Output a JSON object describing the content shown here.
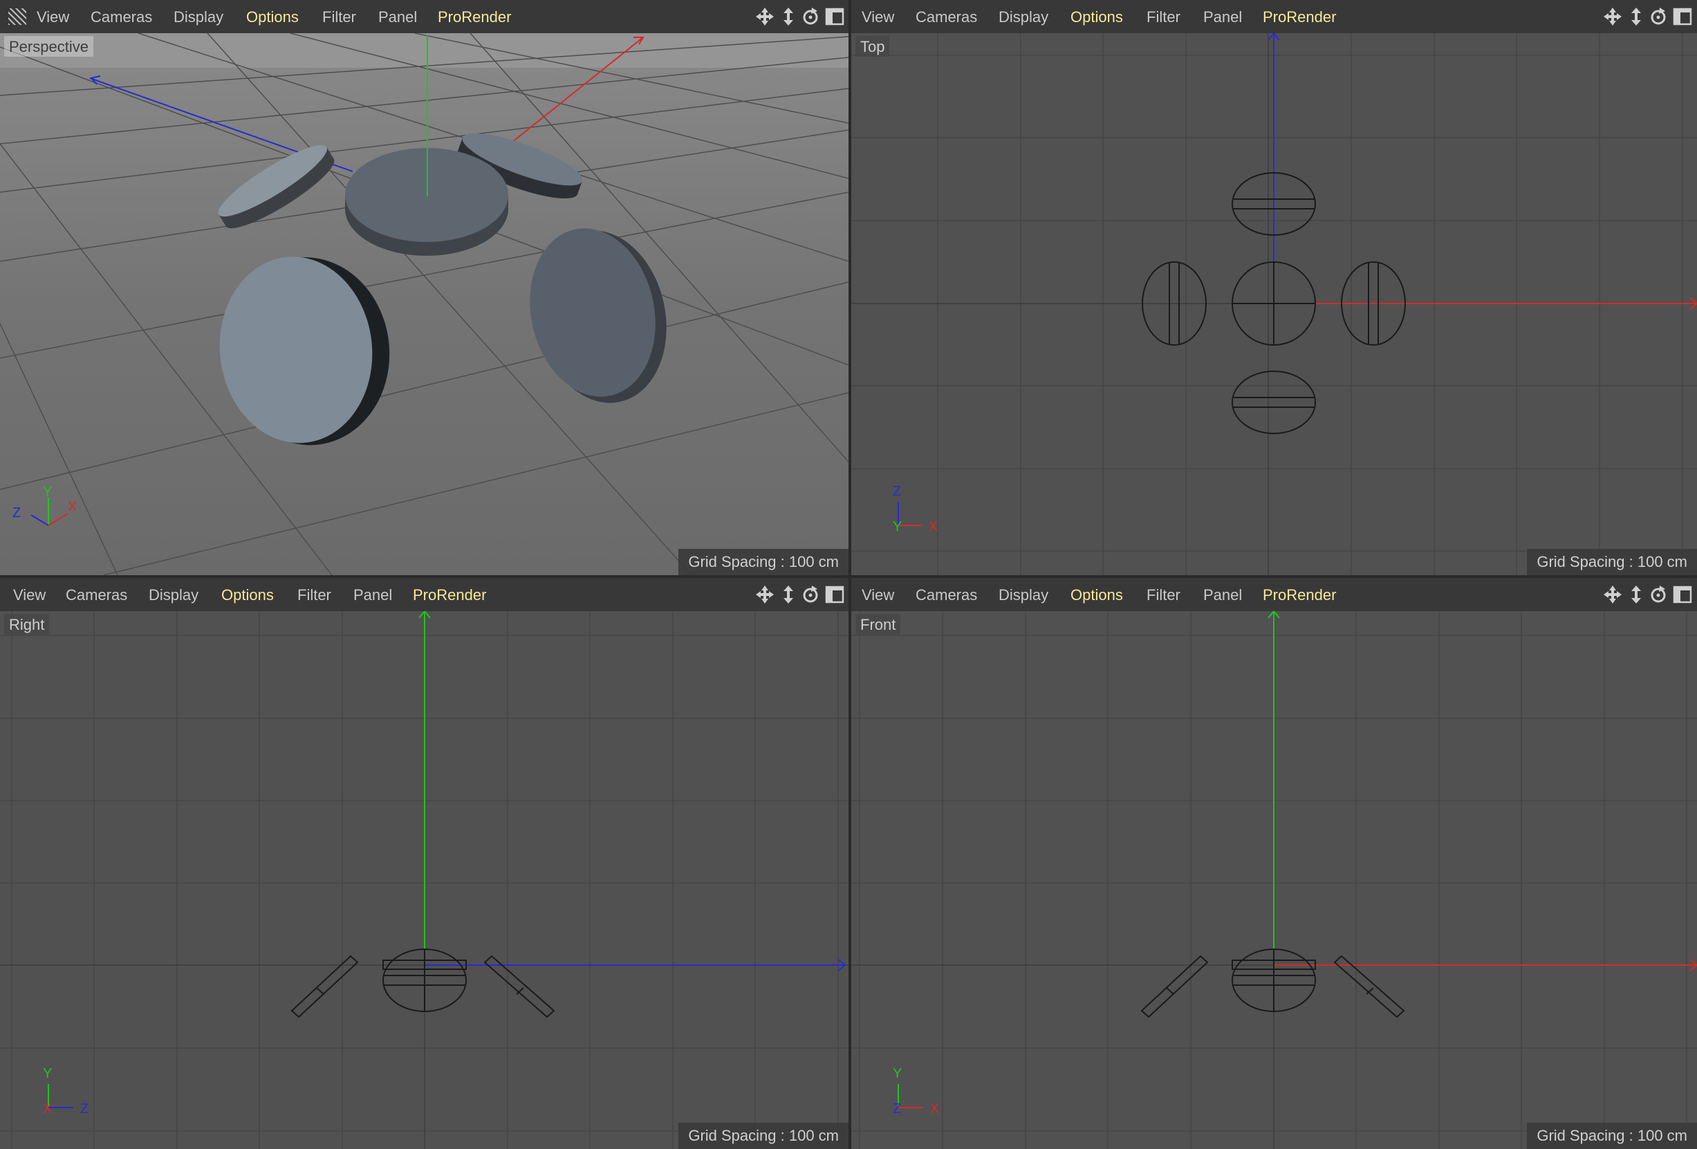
{
  "menu": [
    "View",
    "Cameras",
    "Display",
    "Options",
    "Filter",
    "Panel",
    "ProRender"
  ],
  "highlight_color": "#f7e89a",
  "viewports": {
    "perspective": {
      "label": "Perspective",
      "grid_spacing": "Grid Spacing : 100 cm",
      "gizmo": [
        "Y",
        "X",
        "Z"
      ]
    },
    "top": {
      "label": "Top",
      "grid_spacing": "Grid Spacing : 100 cm",
      "gizmo": [
        "Z",
        "Y",
        "X"
      ]
    },
    "right": {
      "label": "Right",
      "grid_spacing": "Grid Spacing : 100 cm",
      "gizmo": [
        "Y",
        "X",
        "Z"
      ]
    },
    "front": {
      "label": "Front",
      "grid_spacing": "Grid Spacing : 100 cm",
      "gizmo": [
        "Y",
        "Z",
        "X"
      ]
    }
  },
  "nav_icons": [
    "move-view-icon",
    "zoom-view-icon",
    "rotate-view-icon",
    "maximize-view-icon"
  ],
  "axis_colors": {
    "x": "#d62a2a",
    "y": "#2bcf2b",
    "z": "#3a3ad6"
  }
}
